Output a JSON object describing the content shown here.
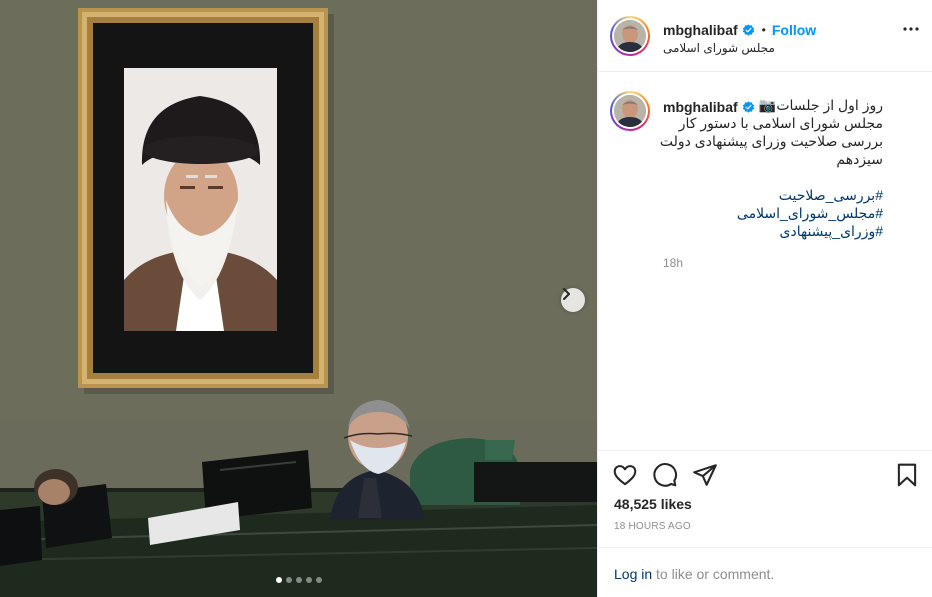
{
  "post": {
    "username": "mbghalibaf",
    "verified": true,
    "follow_label": "Follow",
    "separator": "•",
    "location": "مجلس شورای اسلامی",
    "caption_lines": [
      "روز اول از جلسات📷",
      "مجلس شورای اسلامی با دستور کار",
      "بررسی صلاحیت وزرای پیشنهادی دولت",
      "سیزدهم"
    ],
    "hashtags": [
      "#بررسی_صلاحیت",
      "#مجلس_شورای_اسلامی",
      "#وزرای_پیشنهادی"
    ],
    "relative_time": "18h",
    "likes": "48,525 likes",
    "posted_time": "18 HOURS AGO"
  },
  "carousel": {
    "total": 5,
    "active_index": 0
  },
  "footer": {
    "login_link": "Log in",
    "login_rest": " to like or comment."
  },
  "icons": {
    "verified": "verified-badge-icon",
    "more": "more-options-icon",
    "like": "heart-icon",
    "comment": "comment-icon",
    "share": "share-icon",
    "save": "bookmark-icon",
    "next": "chevron-right-icon"
  },
  "colors": {
    "accent": "#0095f6",
    "link": "#00376b",
    "muted": "#8e8e8e"
  }
}
